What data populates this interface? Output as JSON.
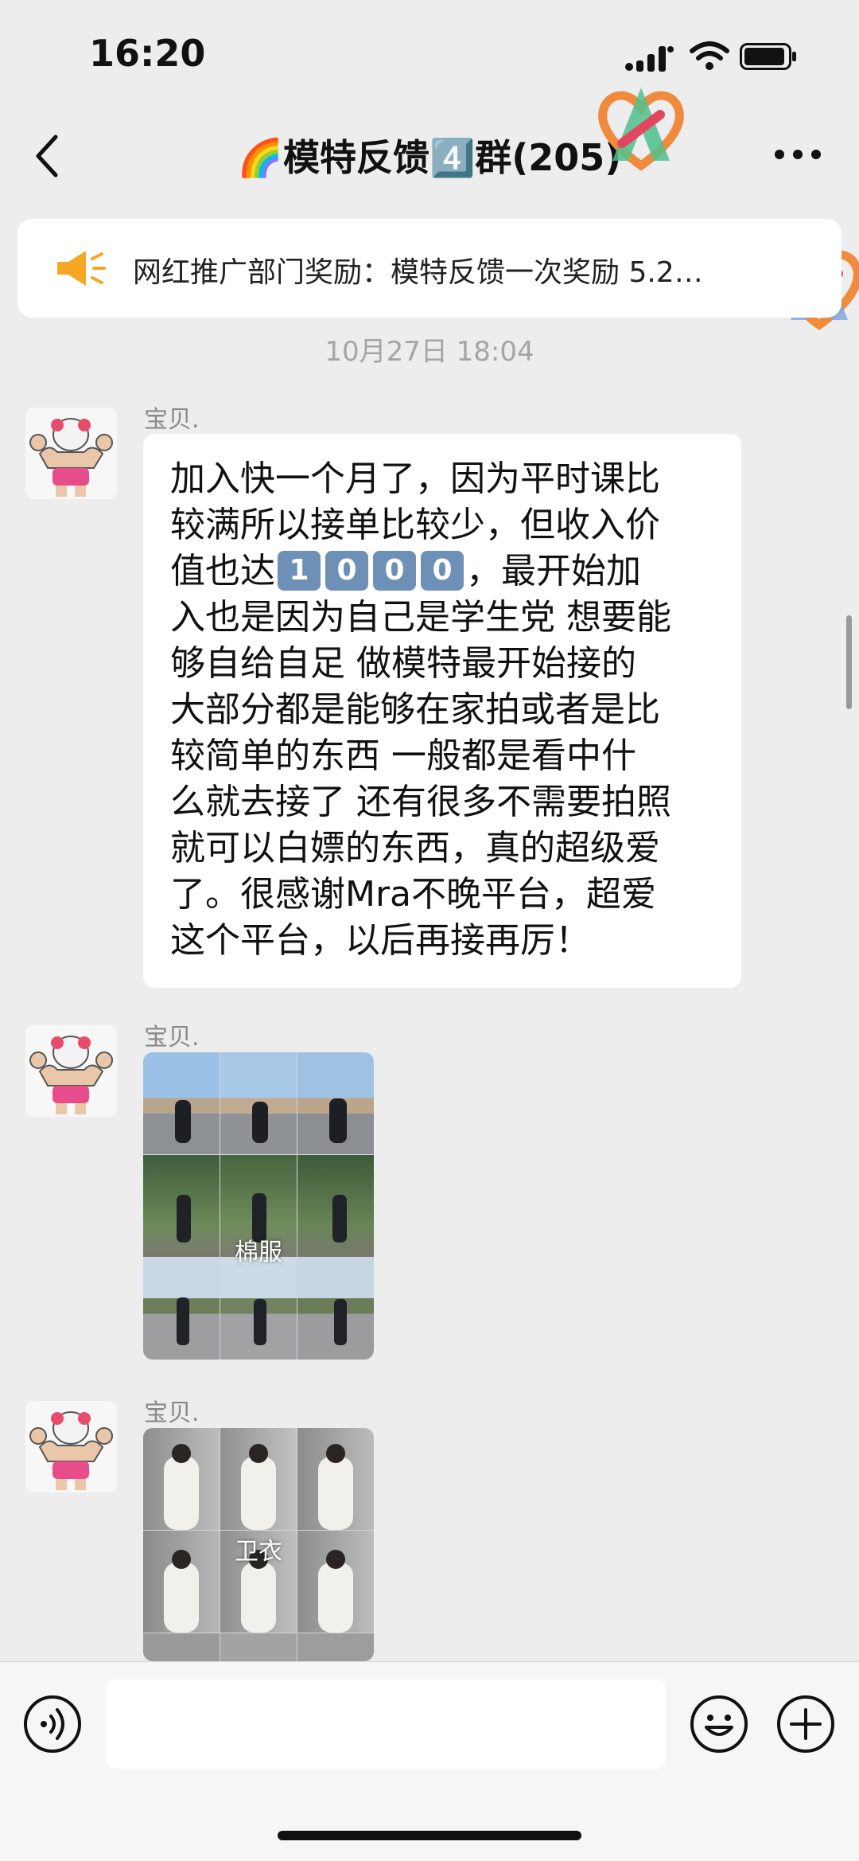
{
  "status_bar": {
    "time": "16:20"
  },
  "header": {
    "title": "🌈模特反馈4️⃣群(205)"
  },
  "notice": {
    "text": "网红推广部门奖励：模特反馈一次奖励 5.2…"
  },
  "messages": {
    "timestamp": "10月27日 18:04",
    "text_message": {
      "sender": "宝贝.",
      "lines": [
        "加入快一个月了，因为平时课比",
        "较满所以接单比较少，但收入价",
        "值也达",
        "，最开始加",
        "入也是因为自己是学生党 想要能",
        "够自给自足 做模特最开始接的",
        "大部分都是能够在家拍或者是比",
        "较简单的东西 一般都是看中什",
        "么就去接了 还有很多不需要拍照",
        "就可以白嫖的东西，真的超级爱",
        "了。很感谢Mra不晚平台，超爱",
        "这个平台，以后再接再厉！"
      ],
      "keycap_digits": [
        "1",
        "0",
        "0",
        "0"
      ]
    },
    "image_message_1": {
      "sender": "宝贝.",
      "label": "棉服"
    },
    "image_message_2": {
      "sender": "宝贝.",
      "label": "卫衣"
    }
  },
  "icons": {
    "back": "chevron-left-icon",
    "more": "more-dots-icon",
    "notice": "megaphone-icon",
    "voice": "voice-icon",
    "emoji": "emoji-icon",
    "plus": "plus-icon",
    "watermark": "heart-logo-icon"
  },
  "colors": {
    "background": "#ededed",
    "bubble": "#ffffff",
    "keycap": "#6f90b6",
    "horn": "#f5a623"
  }
}
